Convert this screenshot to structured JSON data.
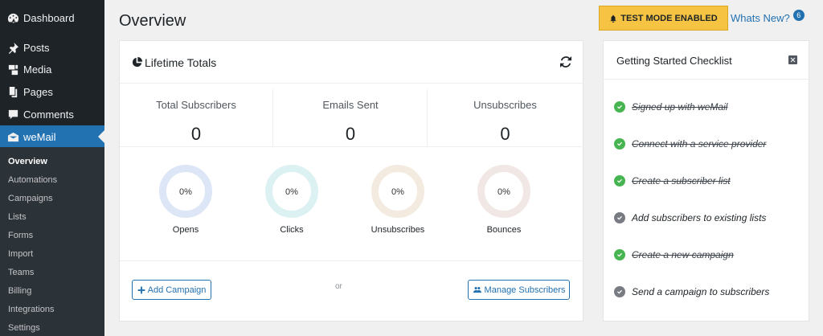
{
  "sidebar": {
    "items": [
      {
        "label": "Dashboard",
        "icon": "dashboard-icon"
      },
      {
        "label": "Posts",
        "icon": "pin-icon"
      },
      {
        "label": "Media",
        "icon": "media-icon"
      },
      {
        "label": "Pages",
        "icon": "pages-icon"
      },
      {
        "label": "Comments",
        "icon": "comment-icon"
      },
      {
        "label": "weMail",
        "icon": "envelope-icon"
      }
    ],
    "submenu": [
      "Overview",
      "Automations",
      "Campaigns",
      "Lists",
      "Forms",
      "Import",
      "Teams",
      "Billing",
      "Integrations",
      "Settings"
    ]
  },
  "header": {
    "title": "Overview",
    "test_mode": "TEST MODE ENABLED",
    "whats_new": "Whats New?",
    "whats_new_count": "6"
  },
  "lifetime": {
    "title": "Lifetime Totals",
    "stats": [
      {
        "label": "Total Subscribers",
        "value": "0"
      },
      {
        "label": "Emails Sent",
        "value": "0"
      },
      {
        "label": "Unsubscribes",
        "value": "0"
      }
    ],
    "rings": [
      {
        "label": "Opens",
        "value": "0%",
        "color": "#dde6f6"
      },
      {
        "label": "Clicks",
        "value": "0%",
        "color": "#dcf1f2"
      },
      {
        "label": "Unsubscribes",
        "value": "0%",
        "color": "#f4ebe0"
      },
      {
        "label": "Bounces",
        "value": "0%",
        "color": "#f1e8e6"
      }
    ],
    "add_campaign": "Add Campaign",
    "or": "or",
    "manage_subscribers": "Manage Subscribers"
  },
  "checklist": {
    "title": "Getting Started Checklist",
    "items": [
      {
        "label": "Signed up with weMail",
        "done": true
      },
      {
        "label": "Connect with a service provider",
        "done": true
      },
      {
        "label": "Create a subscriber list",
        "done": true
      },
      {
        "label": "Add subscribers to existing lists",
        "done": false
      },
      {
        "label": "Create a new campaign",
        "done": true
      },
      {
        "label": "Send a campaign to subscribers",
        "done": false
      }
    ]
  },
  "colors": {
    "accent": "#2271b1",
    "done": "#46b450",
    "todo": "#787c82",
    "test_mode_bg": "#f6c343"
  }
}
